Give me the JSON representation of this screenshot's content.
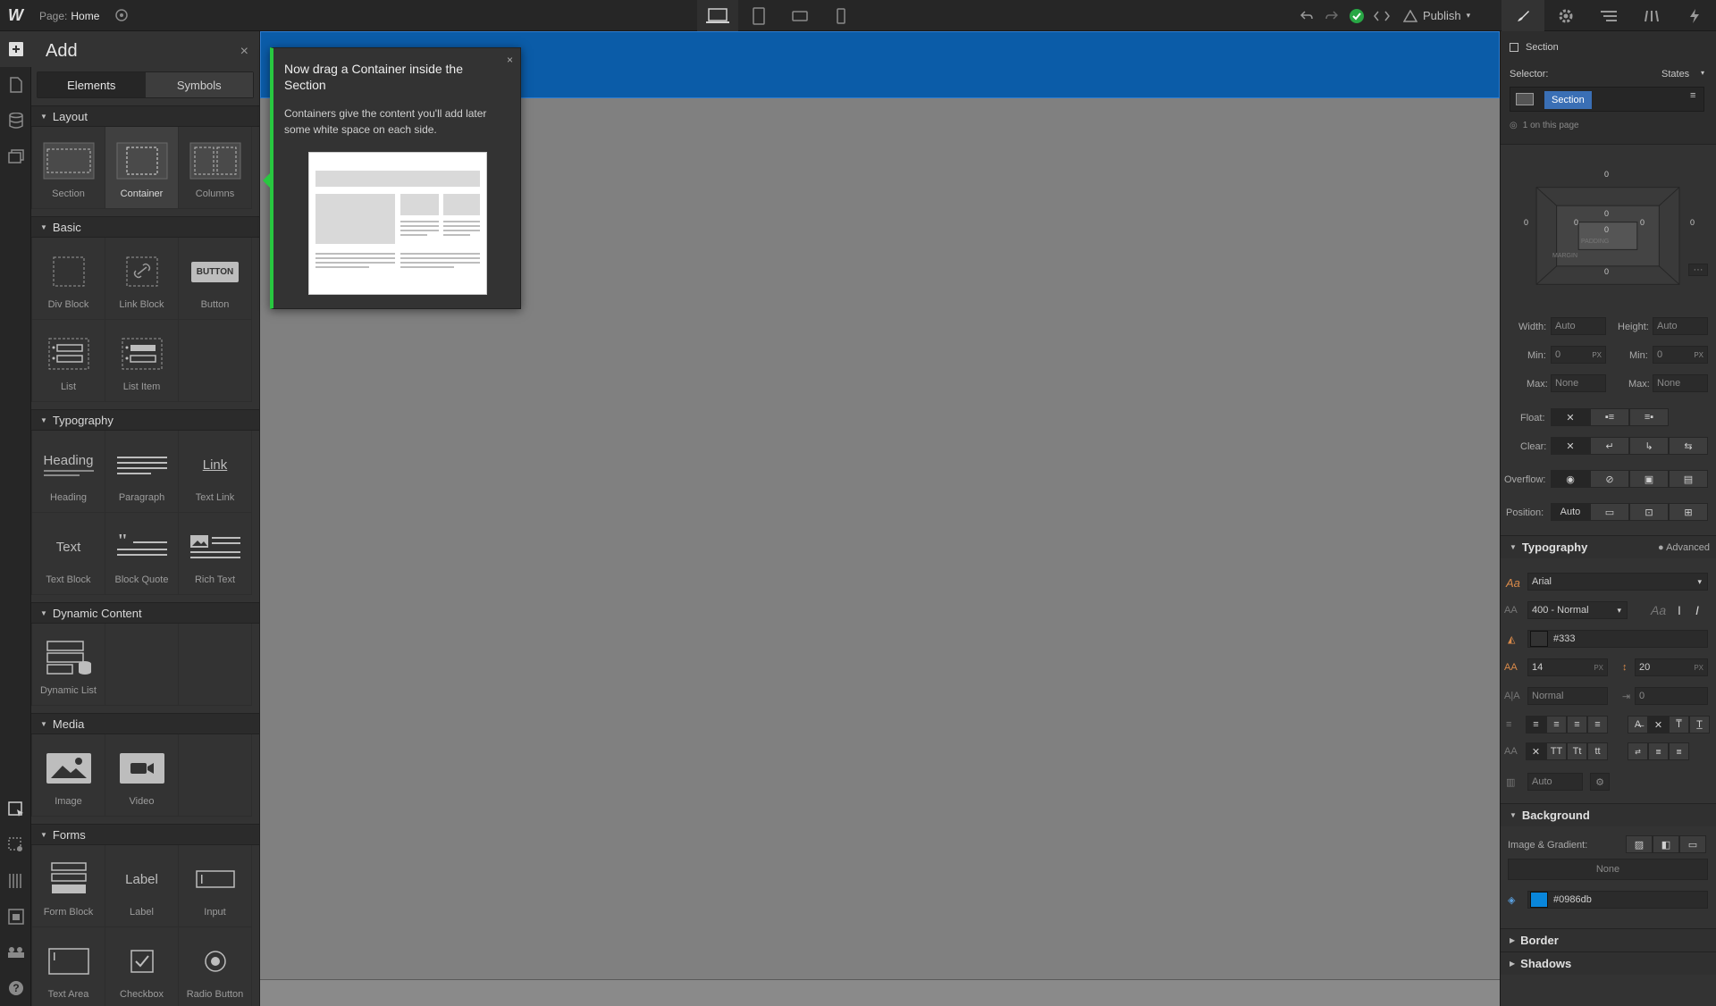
{
  "topbar": {
    "page_prefix": "Page:",
    "page_name": "Home",
    "publish_label": "Publish"
  },
  "add_panel": {
    "title": "Add",
    "tabs": [
      "Elements",
      "Symbols"
    ],
    "categories": {
      "layout": {
        "title": "Layout",
        "items": [
          "Section",
          "Container",
          "Columns"
        ]
      },
      "basic": {
        "title": "Basic",
        "items": [
          "Div Block",
          "Link Block",
          "Button",
          "List",
          "List Item"
        ],
        "button_text": "BUTTON"
      },
      "typography": {
        "title": "Typography",
        "items": [
          "Heading",
          "Paragraph",
          "Text Link",
          "Text Block",
          "Block Quote",
          "Rich Text"
        ],
        "heading_text": "Heading",
        "link_text": "Link",
        "text_text": "Text"
      },
      "dynamic": {
        "title": "Dynamic Content",
        "items": [
          "Dynamic List"
        ]
      },
      "media": {
        "title": "Media",
        "items": [
          "Image",
          "Video"
        ]
      },
      "forms": {
        "title": "Forms",
        "items": [
          "Form Block",
          "Label",
          "Input",
          "Text Area",
          "Checkbox",
          "Radio Button"
        ],
        "label_text": "Label"
      }
    }
  },
  "tooltip": {
    "title": "Now drag a Container inside the Section",
    "body": "Containers give the content you'll add later some white space on each side.",
    "close": "×"
  },
  "right_panel": {
    "element_name": "Section",
    "selector_label": "Selector:",
    "states_label": "States",
    "selector_chip": "Section",
    "on_page": "1 on this page",
    "box": {
      "margin_top": "0",
      "margin_bottom": "0",
      "margin_left": "0",
      "margin_right": "0",
      "pad_top": "0",
      "pad_bottom": "0",
      "pad_left": "0",
      "pad_right": "0",
      "padding_word": "PADDING",
      "margin_word": "MARGIN"
    },
    "width_label": "Width:",
    "width_val": "Auto",
    "height_label": "Height:",
    "height_val": "Auto",
    "min_label": "Min:",
    "min_w": "0",
    "min_h": "0",
    "px": "PX",
    "max_label": "Max:",
    "max_w": "None",
    "max_h": "None",
    "float_label": "Float:",
    "clear_label": "Clear:",
    "overflow_label": "Overflow:",
    "position_label": "Position:",
    "position_val": "Auto",
    "typography_title": "Typography",
    "advanced_label": "Advanced",
    "font": "Arial",
    "weight": "400 - Normal",
    "color": "#333",
    "size": "14",
    "line_height": "20",
    "letter": "Normal",
    "indent": "0",
    "columns": "Auto",
    "background_title": "Background",
    "image_gradient_label": "Image & Gradient:",
    "image_none": "None",
    "bg_color": "#0986db",
    "border_title": "Border",
    "shadows_title": "Shadows",
    "text_case": [
      "TT",
      "Tt",
      "tt"
    ]
  },
  "colors": {
    "accent_green": "#28c840",
    "section_blue": "#0b5ca8",
    "bg_swatch": "#0986db"
  }
}
